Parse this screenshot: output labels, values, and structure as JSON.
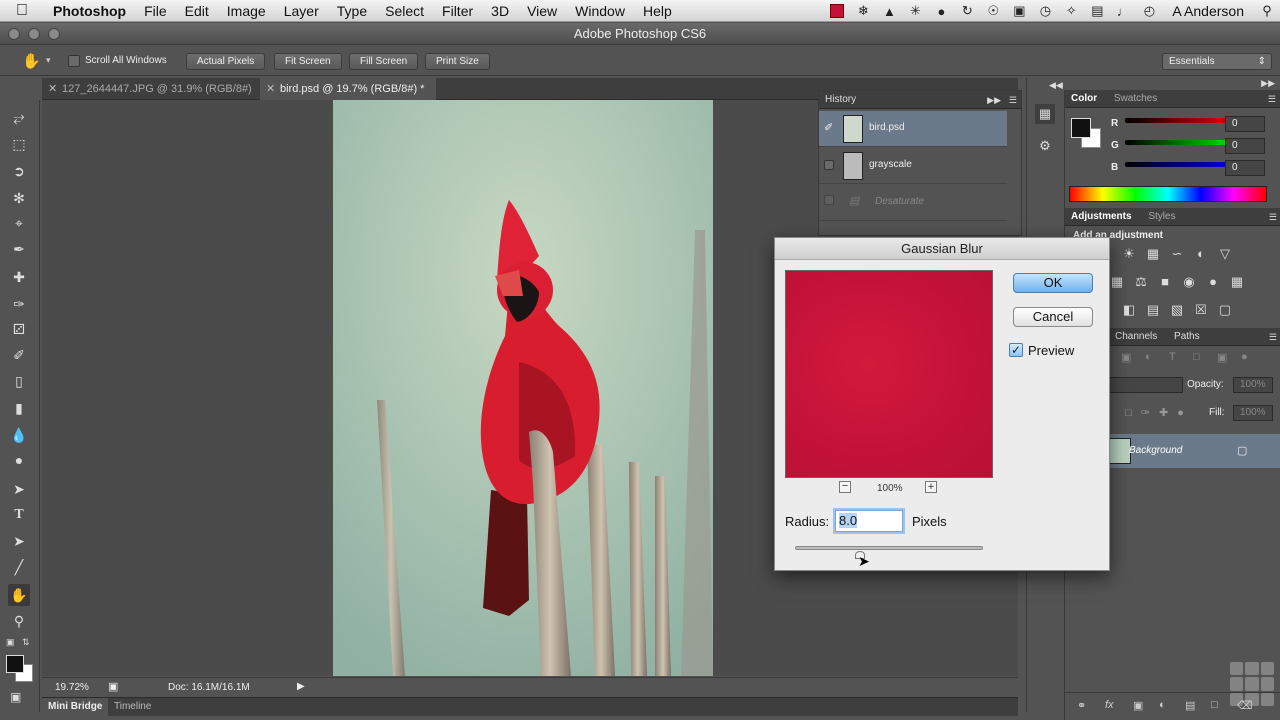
{
  "colors": {
    "menubar_bg": "#e0e0e0",
    "ui_bg": "#535353",
    "accent_red": "#c4123a",
    "default_button": "#6fb1ee"
  },
  "menubar": {
    "app": "Photoshop",
    "items": [
      "File",
      "Edit",
      "Image",
      "Layer",
      "Type",
      "Select",
      "Filter",
      "3D",
      "View",
      "Window",
      "Help"
    ],
    "user": "A Anderson",
    "status_icons": [
      "red-square-icon",
      "dropbox-icon",
      "notification-icon",
      "brightness-icon",
      "paw-icon",
      "sync-icon",
      "accessibility-icon",
      "display-icon",
      "time-machine-icon",
      "bluetooth-icon",
      "battery-icon",
      "volume-icon",
      "clock-icon",
      "search-icon"
    ]
  },
  "window": {
    "title": "Adobe Photoshop CS6"
  },
  "options_bar": {
    "scroll_all_windows": "Scroll All Windows",
    "actual_pixels": "Actual Pixels",
    "fit_screen": "Fit Screen",
    "fill_screen": "Fill Screen",
    "print_size": "Print Size",
    "workspace": "Essentials"
  },
  "doc_tabs": [
    {
      "label": "127_2644447.JPG @ 31.9% (RGB/8#)"
    },
    {
      "label": "bird.psd @ 19.7% (RGB/8#) *"
    }
  ],
  "status_bar": {
    "zoom": "19.72%",
    "doc": "Doc: 16.1M/16.1M"
  },
  "bottom_tabs": {
    "mini_bridge": "Mini Bridge",
    "timeline": "Timeline"
  },
  "history": {
    "title": "History",
    "rows": [
      "bird.psd",
      "grayscale",
      "Desaturate"
    ]
  },
  "color_panel": {
    "tabs": [
      "Color",
      "Swatches"
    ],
    "channels": [
      {
        "label": "R",
        "value": "0"
      },
      {
        "label": "G",
        "value": "0"
      },
      {
        "label": "B",
        "value": "0"
      }
    ]
  },
  "adjustments_panel": {
    "tabs": [
      "Adjustments",
      "Styles"
    ],
    "heading": "Add an adjustment"
  },
  "layers_panel": {
    "tabs": [
      "Channels",
      "Paths"
    ],
    "opacity_label": "Opacity:",
    "opacity_value": "100%",
    "fill_label": "Fill:",
    "fill_value": "100%",
    "layer": "Background"
  },
  "dialog": {
    "title": "Gaussian Blur",
    "ok": "OK",
    "cancel": "Cancel",
    "preview_label": "Preview",
    "zoom": "100%",
    "radius_label": "Radius:",
    "radius_value": "8.0",
    "unit": "Pixels"
  }
}
